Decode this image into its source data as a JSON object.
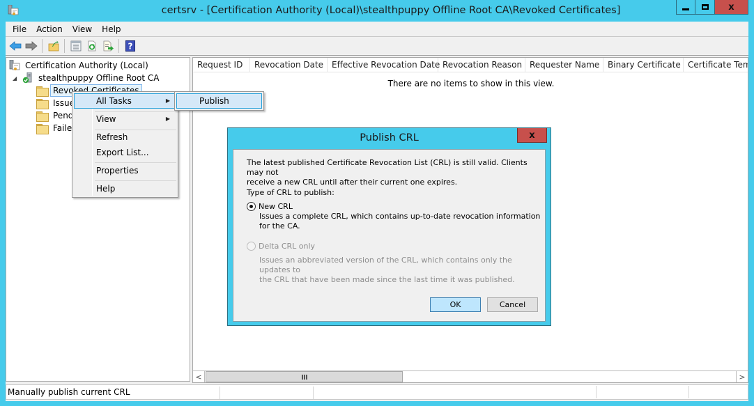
{
  "window": {
    "title": "certsrv - [Certification Authority (Local)\\stealthpuppy Offline Root CA\\Revoked Certificates]",
    "icons": {
      "app": "certsrv-app-icon",
      "minimize": "minimize-icon",
      "maximize": "maximize-icon",
      "close": "close-icon"
    },
    "close_glyph": "x"
  },
  "menubar": {
    "items": [
      "File",
      "Action",
      "View",
      "Help"
    ]
  },
  "toolbar": {
    "buttons": [
      {
        "name": "back",
        "icon": "back-arrow-icon"
      },
      {
        "name": "forward",
        "icon": "forward-arrow-icon"
      },
      {
        "name": "up-one-level",
        "icon": "up-folder-icon"
      },
      {
        "name": "show-hide-console-tree",
        "icon": "console-tree-icon"
      },
      {
        "name": "refresh",
        "icon": "refresh-icon"
      },
      {
        "name": "export-list",
        "icon": "export-list-icon"
      },
      {
        "name": "help",
        "icon": "help-icon"
      }
    ],
    "help_glyph": "?"
  },
  "tree": {
    "root": {
      "label": "Certification Authority (Local)",
      "icon": "certificate-authority-icon"
    },
    "ca": {
      "label": "stealthpuppy Offline Root CA",
      "icon": "ca-server-icon",
      "expander": "◢"
    },
    "folders": [
      {
        "label": "Revoked Certificates",
        "selected": true
      },
      {
        "label": "Issued Certificates",
        "selected": false
      },
      {
        "label": "Pending Requests",
        "selected": false
      },
      {
        "label": "Failed Requests",
        "selected": false
      }
    ]
  },
  "list": {
    "columns": [
      "Request ID",
      "Revocation Date",
      "Effective Revocation Date",
      "Revocation Reason",
      "Requester Name",
      "Binary Certificate",
      "Certificate Template"
    ],
    "empty_message": "There are no items to show in this view.",
    "scroll_left": "<",
    "scroll_right": ">"
  },
  "context_menu": {
    "items": [
      {
        "label": "All Tasks",
        "submenu": true,
        "highlighted": true
      },
      {
        "label": "View",
        "submenu": true,
        "highlighted": false
      },
      {
        "label": "Refresh",
        "submenu": false
      },
      {
        "label": "Export List...",
        "submenu": false
      },
      {
        "label": "Properties",
        "submenu": false
      },
      {
        "label": "Help",
        "submenu": false
      }
    ],
    "arrow_glyph": "▶"
  },
  "submenu": {
    "items": [
      {
        "label": "Publish",
        "highlighted": true
      }
    ]
  },
  "dialog": {
    "title": "Publish CRL",
    "close_glyph": "x",
    "message_line1": "The latest published Certificate Revocation List (CRL) is still valid. Clients may not",
    "message_line2": "receive a new CRL until after their current one expires.",
    "type_label": "Type of CRL to publish:",
    "options": [
      {
        "label": "New CRL",
        "checked": true,
        "enabled": true,
        "desc_line1": "Issues a complete CRL, which contains up-to-date revocation information",
        "desc_line2": "for the CA."
      },
      {
        "label": "Delta CRL only",
        "checked": false,
        "enabled": false,
        "desc_line1": "Issues an abbreviated version of the CRL, which contains only the updates to",
        "desc_line2": "the CRL that have been made since the last time it was published."
      }
    ],
    "ok_label": "OK",
    "cancel_label": "Cancel"
  },
  "statusbar": {
    "text": "Manually publish current CRL"
  },
  "colors": {
    "frame": "#46cbeb",
    "close_button": "#c7504c",
    "highlight": "#d5e8f8",
    "highlight_border": "#26a0da"
  }
}
